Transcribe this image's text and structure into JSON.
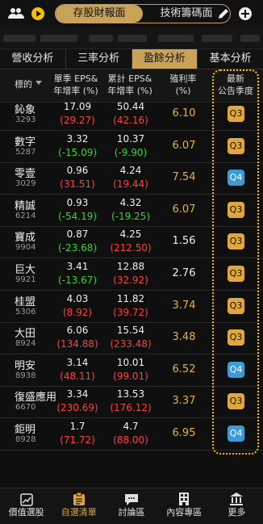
{
  "top": {
    "segments": [
      "存股財報面",
      "技術籌碼面"
    ],
    "active_segment": 0
  },
  "tabs": [
    "營收分析",
    "三率分析",
    "盈餘分析",
    "基本分析"
  ],
  "active_tab": 2,
  "header": {
    "col_name": "標的",
    "col_q_eps": "單季 EPS&",
    "col_q_eps2": "年增率 (%)",
    "col_cum_eps": "累計 EPS&",
    "col_cum_eps2": "年增率 (%)",
    "col_yield": "殖利率",
    "col_yield2": "(%)",
    "col_quarter": "最新",
    "col_quarter2": "公告季度"
  },
  "rows": [
    {
      "name": "鈊象",
      "code": "3293",
      "q_eps": "17.09",
      "q_yoy": "(29.27)",
      "q_yoy_color": "red",
      "cum_eps": "50.44",
      "cum_yoy": "(42.16)",
      "cum_yoy_color": "red",
      "yield": "6.10",
      "yield_color": "gold",
      "quarter": "Q3",
      "quarter_color": "gold"
    },
    {
      "name": "數字",
      "code": "5287",
      "q_eps": "3.32",
      "q_yoy": "(-15.09)",
      "q_yoy_color": "green",
      "cum_eps": "10.37",
      "cum_yoy": "(-9.90)",
      "cum_yoy_color": "green",
      "yield": "6.07",
      "yield_color": "gold",
      "quarter": "Q3",
      "quarter_color": "gold"
    },
    {
      "name": "零壹",
      "code": "3029",
      "q_eps": "0.96",
      "q_yoy": "(31.51)",
      "q_yoy_color": "red",
      "cum_eps": "4.24",
      "cum_yoy": "(19.44)",
      "cum_yoy_color": "red",
      "yield": "7.54",
      "yield_color": "gold",
      "quarter": "Q4",
      "quarter_color": "blue"
    },
    {
      "name": "精誠",
      "code": "6214",
      "q_eps": "0.93",
      "q_yoy": "(-54.19)",
      "q_yoy_color": "green",
      "cum_eps": "4.32",
      "cum_yoy": "(-19.25)",
      "cum_yoy_color": "green",
      "yield": "6.07",
      "yield_color": "gold",
      "quarter": "Q3",
      "quarter_color": "gold"
    },
    {
      "name": "寶成",
      "code": "9904",
      "q_eps": "0.87",
      "q_yoy": "(-23.68)",
      "q_yoy_color": "green",
      "cum_eps": "4.25",
      "cum_yoy": "(212.50)",
      "cum_yoy_color": "red",
      "yield": "1.56",
      "yield_color": "white",
      "quarter": "Q3",
      "quarter_color": "gold"
    },
    {
      "name": "巨大",
      "code": "9921",
      "q_eps": "3.41",
      "q_yoy": "(-13.67)",
      "q_yoy_color": "green",
      "cum_eps": "12.88",
      "cum_yoy": "(32.92)",
      "cum_yoy_color": "red",
      "yield": "2.76",
      "yield_color": "white",
      "quarter": "Q3",
      "quarter_color": "gold"
    },
    {
      "name": "桂盟",
      "code": "5306",
      "q_eps": "4.03",
      "q_yoy": "(8.92)",
      "q_yoy_color": "red",
      "cum_eps": "11.82",
      "cum_yoy": "(39.72)",
      "cum_yoy_color": "red",
      "yield": "3.74",
      "yield_color": "gold",
      "quarter": "Q3",
      "quarter_color": "gold"
    },
    {
      "name": "大田",
      "code": "8924",
      "q_eps": "6.06",
      "q_yoy": "(134.88)",
      "q_yoy_color": "red",
      "cum_eps": "15.54",
      "cum_yoy": "(233.48)",
      "cum_yoy_color": "red",
      "yield": "3.48",
      "yield_color": "gold",
      "quarter": "Q3",
      "quarter_color": "gold"
    },
    {
      "name": "明安",
      "code": "8938",
      "q_eps": "3.14",
      "q_yoy": "(48.11)",
      "q_yoy_color": "red",
      "cum_eps": "10.01",
      "cum_yoy": "(99.01)",
      "cum_yoy_color": "red",
      "yield": "6.52",
      "yield_color": "gold",
      "quarter": "Q4",
      "quarter_color": "blue"
    },
    {
      "name": "復盛應用",
      "code": "6670",
      "q_eps": "3.34",
      "q_yoy": "(230.69)",
      "q_yoy_color": "red",
      "cum_eps": "13.53",
      "cum_yoy": "(176.12)",
      "cum_yoy_color": "red",
      "yield": "3.37",
      "yield_color": "gold",
      "quarter": "Q3",
      "quarter_color": "gold"
    },
    {
      "name": "鉅明",
      "code": "8928",
      "q_eps": "1.7",
      "q_yoy": "(71.72)",
      "q_yoy_color": "red",
      "cum_eps": "4.7",
      "cum_yoy": "(88.00)",
      "cum_yoy_color": "red",
      "yield": "6.95",
      "yield_color": "gold",
      "quarter": "Q4",
      "quarter_color": "blue"
    }
  ],
  "nav": [
    {
      "label": "價值選股",
      "icon": "chart-icon"
    },
    {
      "label": "自選清單",
      "icon": "clipboard-icon"
    },
    {
      "label": "討論區",
      "icon": "chat-icon"
    },
    {
      "label": "內容專區",
      "icon": "building-icon"
    },
    {
      "label": "更多",
      "icon": "bank-icon"
    }
  ],
  "active_nav": 1,
  "colors": {
    "gold": "#c9a25a",
    "red": "#ff4040",
    "green": "#3ad13a",
    "blue": "#3d9ad8",
    "highlight": "#f2c200"
  }
}
